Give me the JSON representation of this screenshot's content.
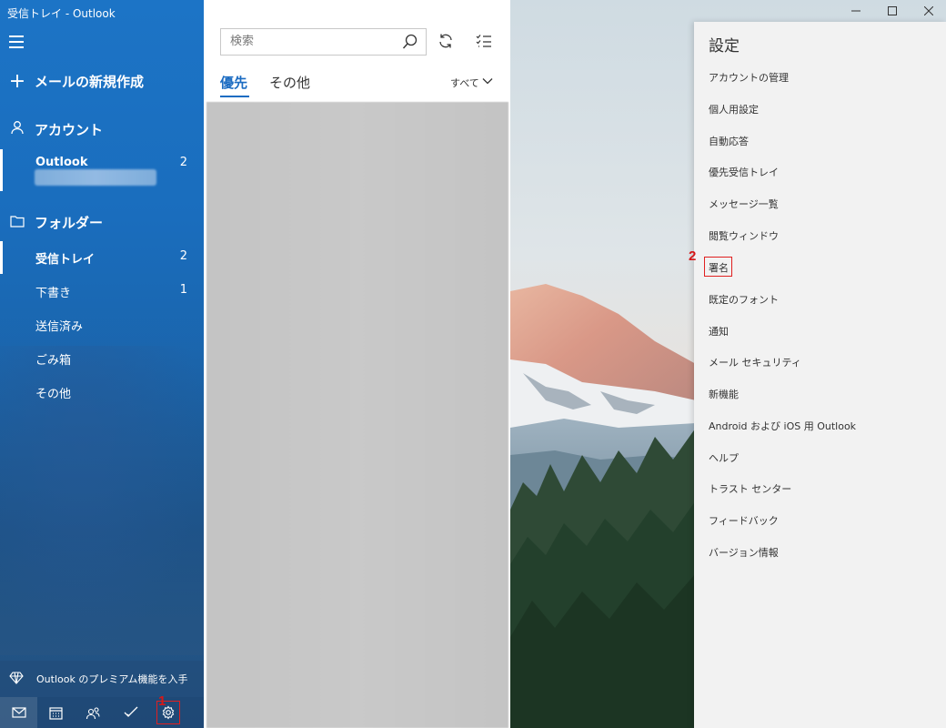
{
  "window": {
    "title": "受信トレイ - Outlook",
    "controls": [
      "minimize-icon",
      "maximize-icon",
      "close-icon"
    ]
  },
  "nav": {
    "new_mail": "メールの新規作成",
    "accounts_header": "アカウント",
    "account": {
      "name": "Outlook",
      "count": "2"
    },
    "folders_header": "フォルダー",
    "folders": [
      {
        "label": "受信トレイ",
        "count": "2",
        "selected": true
      },
      {
        "label": "下書き",
        "count": "1"
      },
      {
        "label": "送信済み",
        "count": ""
      },
      {
        "label": "ごみ箱",
        "count": ""
      },
      {
        "label": "その他",
        "count": ""
      }
    ],
    "premium": "Outlook のプレミアム機能を入手",
    "bottom_icons": [
      "mail-icon",
      "calendar-icon",
      "people-icon",
      "todo-icon",
      "settings-gear-icon"
    ]
  },
  "list": {
    "search_placeholder": "検索",
    "tabs": [
      "優先",
      "その他"
    ],
    "filter": "すべて"
  },
  "settings": {
    "title": "設定",
    "items": [
      "アカウントの管理",
      "個人用設定",
      "自動応答",
      "優先受信トレイ",
      "メッセージ一覧",
      "閲覧ウィンドウ",
      "署名",
      "既定のフォント",
      "通知",
      "メール セキュリティ",
      "新機能",
      "Android および iOS 用 Outlook",
      "ヘルプ",
      "トラスト センター",
      "フィードバック",
      "バージョン情報"
    ]
  },
  "annotations": {
    "step1": "1",
    "step2": "2",
    "color": "#d61818"
  },
  "colors": {
    "accent": "#1c6cc2",
    "nav_bg": "#1a6dbd",
    "settings_bg": "#f2f2f2"
  }
}
